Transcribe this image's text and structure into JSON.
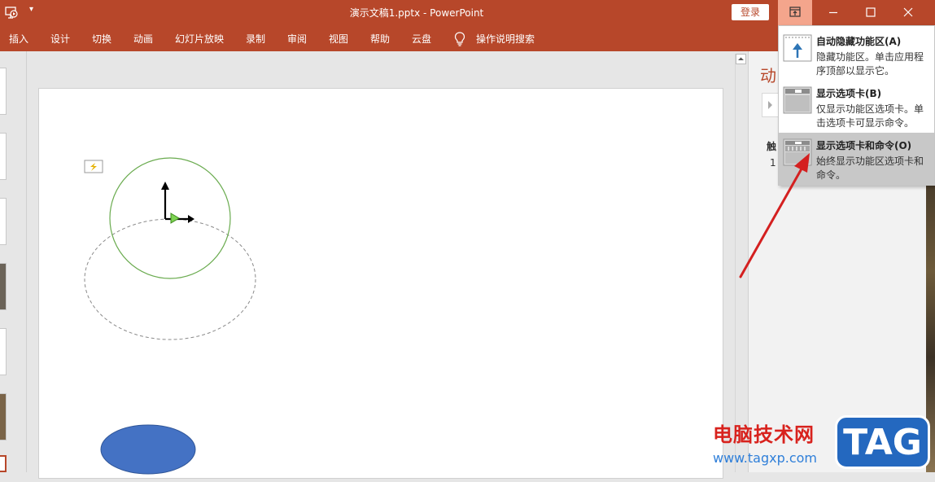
{
  "titlebar": {
    "title": "演示文稿1.pptx  -  PowerPoint",
    "login_label": "登录",
    "qat_dropdown": "▾"
  },
  "tabs": [
    {
      "label": "插入"
    },
    {
      "label": "设计"
    },
    {
      "label": "切换"
    },
    {
      "label": "动画"
    },
    {
      "label": "幻灯片放映"
    },
    {
      "label": "录制"
    },
    {
      "label": "审阅"
    },
    {
      "label": "视图"
    },
    {
      "label": "帮助"
    },
    {
      "label": "云盘"
    }
  ],
  "tell_me": {
    "label": "操作说明搜索"
  },
  "ribbon_menu": {
    "items": [
      {
        "title": "自动隐藏功能区(A)",
        "desc": "隐藏功能区。单击应用程序顶部以显示它。",
        "icon": "auto-hide-ribbon-icon"
      },
      {
        "title": "显示选项卡(B)",
        "desc": "仅显示功能区选项卡。单击选项卡可显示命令。",
        "icon": "show-tabs-icon"
      },
      {
        "title": "显示选项卡和命令(O)",
        "desc": "始终显示功能区选项卡和命令。",
        "icon": "show-tabs-commands-icon"
      }
    ],
    "selected_index": 2
  },
  "animation_pane": {
    "title": "动",
    "trigger_head": "触",
    "item_number": "1"
  },
  "watermark": {
    "text": "电脑技术网",
    "url": "www.tagxp.com",
    "badge": "TAG"
  },
  "colors": {
    "accent": "#b7472a",
    "circle_stroke": "#6aab4f",
    "ellipse_fill": "#4472c4",
    "arrow": "#d42020"
  }
}
